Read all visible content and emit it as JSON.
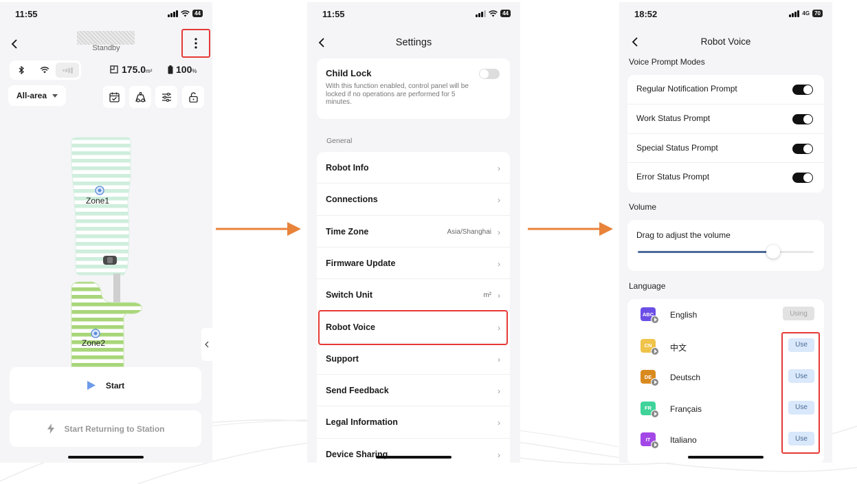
{
  "colors": {
    "highlight": "#e53935",
    "arrow": "#e8833a",
    "toggle_on": "#111111",
    "use_button_bg": "#d9e8fb",
    "slider_fill": "#4c6a99"
  },
  "panel1": {
    "status_time": "11:55",
    "battery_badge": "44",
    "status_text": "Standby",
    "area_value": "175.0",
    "area_unit": "m²",
    "battery_value": "100",
    "battery_unit": "%",
    "area_mode": "All-area",
    "zones": [
      "Zone1",
      "Zone2"
    ],
    "start_label": "Start",
    "return_label": "Start Returning to Station"
  },
  "panel2": {
    "status_time": "11:55",
    "battery_badge": "44",
    "title": "Settings",
    "child_lock": {
      "title": "Child Lock",
      "description": "With this function enabled, control panel will be locked if no operations are performed for 5 minutes."
    },
    "section_general": "General",
    "rows": [
      {
        "label": "Robot Info",
        "value": ""
      },
      {
        "label": "Connections",
        "value": ""
      },
      {
        "label": "Time Zone",
        "value": "Asia/Shanghai"
      },
      {
        "label": "Firmware Update",
        "value": ""
      },
      {
        "label": "Switch Unit",
        "value": "m²"
      },
      {
        "label": "Robot Voice",
        "value": ""
      },
      {
        "label": "Support",
        "value": ""
      },
      {
        "label": "Send Feedback",
        "value": ""
      },
      {
        "label": "Legal Information",
        "value": ""
      },
      {
        "label": "Device Sharing",
        "value": ""
      }
    ]
  },
  "panel3": {
    "status_time": "18:52",
    "network": "4G",
    "battery_badge": "70",
    "title": "Robot Voice",
    "section_prompts": "Voice Prompt Modes",
    "prompts": [
      {
        "label": "Regular Notification Prompt",
        "enabled": true
      },
      {
        "label": "Work Status Prompt",
        "enabled": true
      },
      {
        "label": "Special Status Prompt",
        "enabled": true
      },
      {
        "label": "Error Status Prompt",
        "enabled": true
      }
    ],
    "section_volume": "Volume",
    "volume_label": "Drag to adjust the volume",
    "volume_fraction": 0.77,
    "section_language": "Language",
    "languages": [
      {
        "code": "ABC",
        "name": "English",
        "button": "Using",
        "color": "#6b4ee6"
      },
      {
        "code": "CN",
        "name": "中文",
        "button": "Use",
        "color": "#f0c34a"
      },
      {
        "code": "DE",
        "name": "Deutsch",
        "button": "Use",
        "color": "#d98a1f"
      },
      {
        "code": "FR",
        "name": "Français",
        "button": "Use",
        "color": "#3fd39a"
      },
      {
        "code": "IT",
        "name": "Italiano",
        "button": "Use",
        "color": "#a347e6"
      }
    ]
  }
}
